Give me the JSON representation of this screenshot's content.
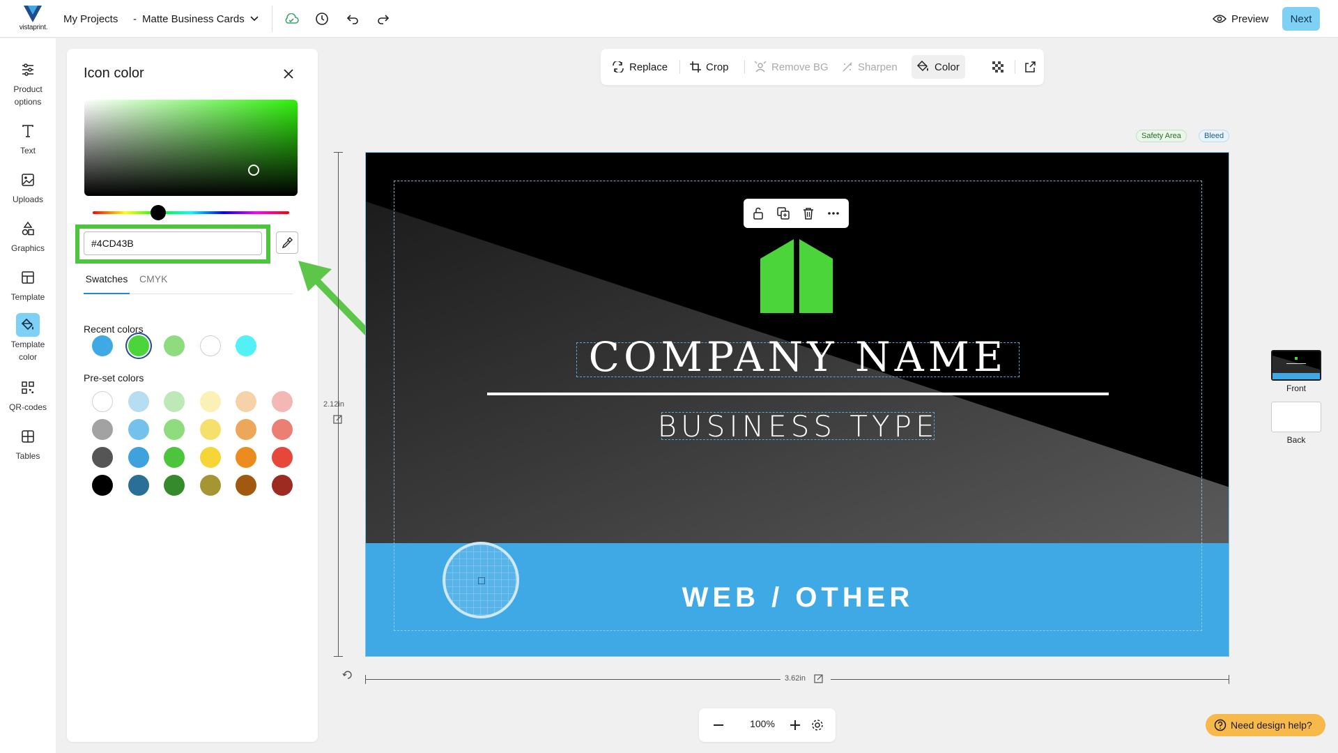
{
  "brand": {
    "logo_text": "vistaprint."
  },
  "header": {
    "my_projects": "My Projects",
    "project_title": "Matte Business Cards",
    "project_prefix": "-",
    "preview_label": "Preview",
    "next_label": "Next"
  },
  "rail": {
    "items": [
      {
        "label1": "Product",
        "label2": "options"
      },
      {
        "label1": "Text",
        "label2": ""
      },
      {
        "label1": "Uploads",
        "label2": ""
      },
      {
        "label1": "Graphics",
        "label2": ""
      },
      {
        "label1": "Template",
        "label2": ""
      },
      {
        "label1": "Template",
        "label2": "color"
      },
      {
        "label1": "QR-codes",
        "label2": ""
      },
      {
        "label1": "Tables",
        "label2": ""
      }
    ]
  },
  "color_panel": {
    "title": "Icon color",
    "hex_value": "#4CD43B",
    "tabs": [
      "Swatches",
      "CMYK"
    ],
    "recent_label": "Recent colors",
    "preset_label": "Pre-set colors",
    "recent_colors": [
      "#3fa9e5",
      "#4cd43b",
      "#8fdc7f",
      "#ffffff",
      "#52f1f5"
    ],
    "preset_colors": [
      [
        "#ffffff",
        "#b7ddf3",
        "#bfe8b9",
        "#fbf0b5",
        "#f6d2a9",
        "#f3b8b4"
      ],
      [
        "#a2a2a2",
        "#73c1ec",
        "#8fdc7f",
        "#f6e06d",
        "#eda75a",
        "#ec7f74"
      ],
      [
        "#555555",
        "#3fa2dc",
        "#4cc43b",
        "#f6d536",
        "#ec8c1f",
        "#e7463a"
      ],
      [
        "#000000",
        "#2a6f97",
        "#358a2c",
        "#a59533",
        "#a1590f",
        "#9d2b22"
      ]
    ],
    "selected": "#4cd43b"
  },
  "canvas_toolbar": {
    "replace": "Replace",
    "crop": "Crop",
    "remove_bg": "Remove BG",
    "sharpen": "Sharpen",
    "color": "Color"
  },
  "guides": {
    "safety": "Safety Area",
    "bleed": "Bleed"
  },
  "card": {
    "company_name": "COMPANY NAME",
    "business_type": "BUSINESS TYPE",
    "web": "WEB / OTHER",
    "icon_color": "#4CD43B",
    "band_color": "#3fa9e5"
  },
  "dimensions": {
    "height": "2.12in",
    "width": "3.62in"
  },
  "sides": {
    "front": "Front",
    "back": "Back"
  },
  "zoom": {
    "value": "100%"
  },
  "help": {
    "label": "Need design help?"
  }
}
